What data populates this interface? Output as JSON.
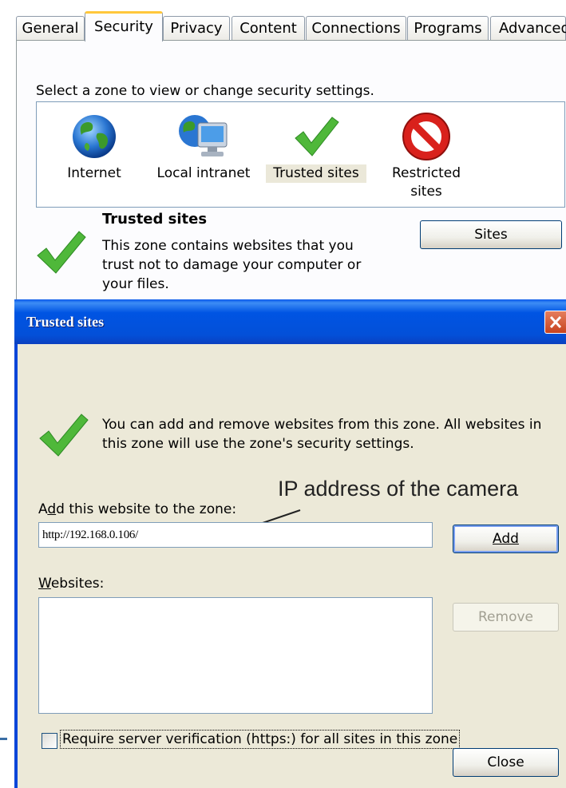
{
  "tabs": [
    "General",
    "Security",
    "Privacy",
    "Content",
    "Connections",
    "Programs",
    "Advanced"
  ],
  "active_tab": "Security",
  "zone_prompt": "Select a zone to view or change security settings.",
  "zones": {
    "internet": "Internet",
    "intranet": "Local intranet",
    "trusted": "Trusted sites",
    "restricted_line1": "Restricted",
    "restricted_line2": "sites"
  },
  "zone_info": {
    "title": "Trusted sites",
    "description": "This zone contains websites that you trust not to damage your computer or your files.",
    "sites_button": "Sites"
  },
  "dialog": {
    "title": "Trusted sites",
    "info": "You can add and remove websites from this zone. All websites in this zone will use the zone's security settings.",
    "add_label": "Add this website to the zone:",
    "url_value": "http://192.168.0.106/",
    "add_button": "Add",
    "websites_label": "Websites:",
    "remove_button": "Remove",
    "require_https_label": "Require server verification (https:) for all sites in this zone",
    "require_https_checked": false,
    "close_button": "Close"
  },
  "annotation": "IP address of the camera"
}
